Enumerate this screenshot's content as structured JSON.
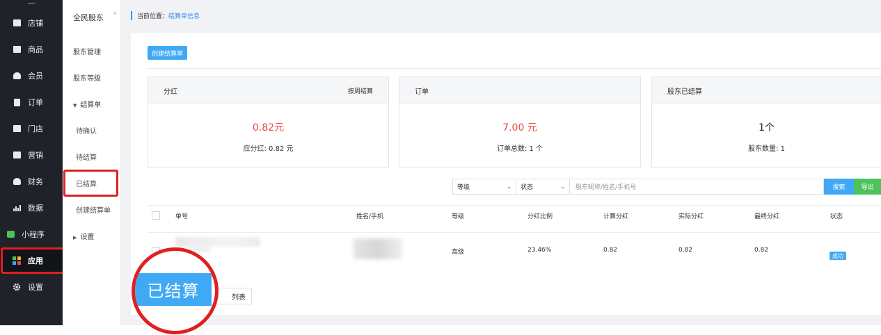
{
  "nav": {
    "items": [
      {
        "label": "店铺",
        "icon": "store-icon"
      },
      {
        "label": "商品",
        "icon": "goods-icon"
      },
      {
        "label": "会员",
        "icon": "member-icon"
      },
      {
        "label": "订单",
        "icon": "order-icon"
      },
      {
        "label": "门店",
        "icon": "shop-icon"
      },
      {
        "label": "营销",
        "icon": "marketing-icon"
      },
      {
        "label": "财务",
        "icon": "finance-icon"
      },
      {
        "label": "数据",
        "icon": "data-icon"
      },
      {
        "label": "小程序",
        "icon": "miniprogram-icon"
      },
      {
        "label": "应用",
        "icon": "apps-icon"
      },
      {
        "label": "设置",
        "icon": "gear-icon"
      }
    ]
  },
  "subnav": {
    "title": "全民股东",
    "items": [
      "股东管理",
      "股东等级"
    ],
    "group": "结算单",
    "group_items": [
      "待确认",
      "待结算",
      "已结算",
      "创建结算单"
    ],
    "settings": "设置"
  },
  "breadcrumb": {
    "label": "当前位置：",
    "current": "结算单信息"
  },
  "toolbar": {
    "create_label": "创建结算单"
  },
  "cards": [
    {
      "title": "分红",
      "side": "按周结算",
      "value": "0.82元",
      "sub": "应分红: 0.82 元"
    },
    {
      "title": "订单",
      "side": "",
      "value": "7.00 元",
      "sub": "订单总数: 1 个"
    },
    {
      "title": "股东已结算",
      "side": "",
      "value": "1个",
      "sub": "股东数量: 1"
    }
  ],
  "filter": {
    "level": "等级",
    "status": "状态",
    "search_placeholder": "股东昵称/姓名/手机号",
    "search_label": "搜索",
    "export_label": "导出"
  },
  "table": {
    "headers": [
      "单号",
      "姓名/手机",
      "等级",
      "分红比例",
      "计算分红",
      "实际分红",
      "最终分红",
      "状态"
    ],
    "rows": [
      {
        "level": "高级",
        "ratio": "23.46%",
        "calc": "0.82",
        "actual": "0.82",
        "final": "0.82",
        "status": "成功"
      }
    ]
  },
  "back": {
    "label": "列表"
  },
  "annotation": {
    "label": "已结算"
  },
  "colors": {
    "accent": "#3fa9f5",
    "export": "#4dc35b",
    "highlight": "#e02020",
    "value_red": "#e84c3d"
  }
}
